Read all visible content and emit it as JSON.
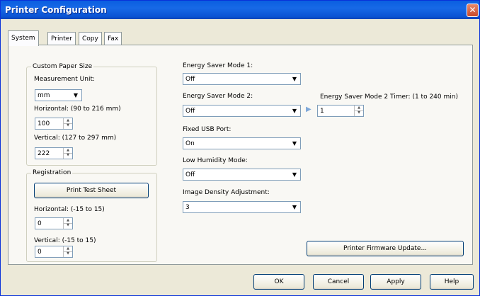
{
  "window": {
    "title": "Printer Configuration",
    "close_glyph": "✕"
  },
  "tabs": [
    {
      "label": "System",
      "active": true
    },
    {
      "label": "Printer"
    },
    {
      "label": "Copy"
    },
    {
      "label": "Fax"
    }
  ],
  "custom_paper": {
    "group_label": "Custom Paper Size",
    "measurement_label": "Measurement Unit:",
    "measurement_value": "mm",
    "horizontal_label": "Horizontal: (90 to 216 mm)",
    "horizontal_value": "100",
    "vertical_label": "Vertical: (127 to 297 mm)",
    "vertical_value": "222"
  },
  "registration": {
    "group_label": "Registration",
    "print_test_label": "Print Test Sheet",
    "horizontal_label": "Horizontal: (-15 to 15)",
    "horizontal_value": "0",
    "vertical_label": "Vertical:  (-15 to 15)",
    "vertical_value": "0"
  },
  "settings": {
    "energy1_label": "Energy Saver Mode 1:",
    "energy1_value": "Off",
    "energy2_label": "Energy Saver Mode 2:",
    "energy2_value": "Off",
    "energy2_timer_label": "Energy Saver Mode 2 Timer: (1 to 240 min)",
    "energy2_timer_value": "1",
    "usb_label": "Fixed USB Port:",
    "usb_value": "On",
    "humidity_label": "Low Humidity Mode:",
    "humidity_value": "Off",
    "density_label": "Image Density Adjustment:",
    "density_value": "3"
  },
  "firmware_button": "Printer Firmware Update...",
  "footer": {
    "ok": "OK",
    "cancel": "Cancel",
    "apply": "Apply",
    "help": "Help"
  },
  "icons": {
    "dropdown": "chevron-down-icon",
    "spin": "spin-arrows-icon",
    "pointer": "triangle-right-icon"
  }
}
